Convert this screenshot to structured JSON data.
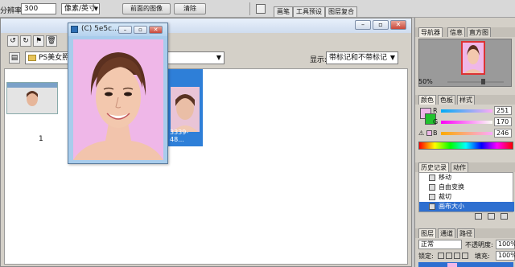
{
  "options_bar": {
    "resolution_label": "分辨率:",
    "resolution_value": "300",
    "unit_select": "像素/英寸",
    "front_image_button": "前面的图像",
    "clear_button": "清除"
  },
  "palette_well": {
    "tabs": [
      "画笔",
      "工具预设",
      "图层复合"
    ]
  },
  "bridge": {
    "location": "PS美女照",
    "show_label": "显示:",
    "show_value": "带标记和不带标记",
    "thumb_index": "1",
    "selected_caption": "3339-48..."
  },
  "doc_window": {
    "title": "(C) 5e5c..."
  },
  "navigator": {
    "tabs": [
      "导航器",
      "信息",
      "直方图"
    ],
    "zoom": "50%"
  },
  "color_panel": {
    "tabs": [
      "颜色",
      "色板",
      "样式"
    ],
    "r_label": "R",
    "r_value": "251",
    "g_label": "G",
    "g_value": "170",
    "b_label": "B",
    "b_value": "246"
  },
  "history_panel": {
    "tabs": [
      "历史记录",
      "动作"
    ],
    "items": [
      "移动",
      "自由变换",
      "裁切",
      "画布大小"
    ]
  },
  "layers_panel": {
    "tabs": [
      "图层",
      "通道",
      "路径"
    ],
    "blend_mode": "正常",
    "opacity_label": "不透明度:",
    "opacity_value": "100%",
    "lock_label": "锁定:",
    "fill_label": "填充:",
    "fill_value": "100%"
  },
  "colors": {
    "foreground": "#efb7e8",
    "background": "#22c22e",
    "selection": "#2e6fd0"
  }
}
